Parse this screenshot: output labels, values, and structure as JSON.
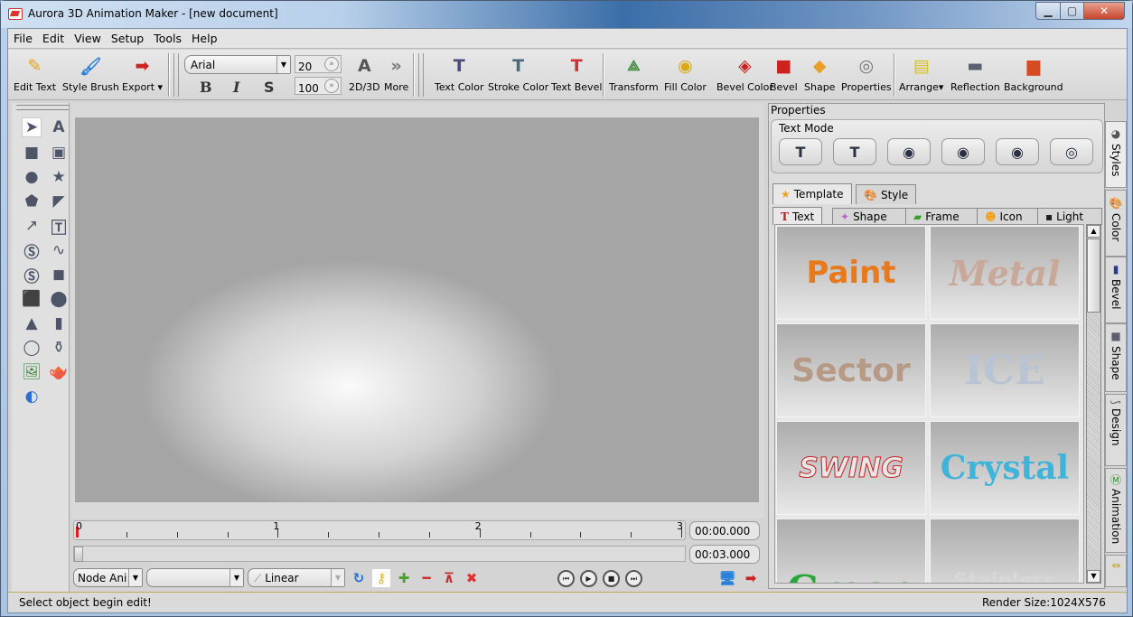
{
  "window": {
    "title": "Aurora 3D Animation Maker - [new document]"
  },
  "menu": [
    "File",
    "Edit",
    "View",
    "Setup",
    "Tools",
    "Help"
  ],
  "toolbar": {
    "edit_text": "Edit Text",
    "style_brush": "Style Brush",
    "export": "Export",
    "font": "Arial",
    "font_size": "20",
    "depth": "100",
    "bold": "B",
    "italic": "I",
    "strike": "S",
    "mode_2d3d": "2D/3D",
    "more": "More",
    "text_color": "Text Color",
    "stroke_color": "Stroke Color",
    "text_bevel": "Text Bevel",
    "transform": "Transform",
    "fill_color": "Fill Color",
    "bevel_color": "Bevel Color",
    "bevel": "Bevel",
    "shape": "Shape",
    "properties": "Properties",
    "arrange": "Arrange",
    "reflection": "Reflection",
    "background": "Background"
  },
  "timeline": {
    "labels": [
      "0",
      "1",
      "2",
      "3"
    ],
    "current_time": "00:00.000",
    "total_time": "00:03.000",
    "anim_type": "Node Ani",
    "anim_target": "",
    "interpolation": "Linear"
  },
  "status": {
    "message": "Select object begin edit!",
    "render_size": "Render Size:1024X576"
  },
  "properties": {
    "title": "Properties",
    "text_mode_label": "Text Mode",
    "tabs": [
      "Template",
      "Style"
    ],
    "subtabs": [
      "Text",
      "Shape",
      "Frame",
      "Icon",
      "Light"
    ],
    "templates": [
      {
        "label": "Paint",
        "color": "#e87a1e"
      },
      {
        "label": "Metal",
        "color": "#c8a898"
      },
      {
        "label": "Sector",
        "color": "#b79a86"
      },
      {
        "label": "ICE",
        "color": "#b8c4d4"
      },
      {
        "label": "SWING",
        "color": "#e8e8e8"
      },
      {
        "label": "Crystal",
        "color": "#3fb4d8"
      },
      {
        "label": "Green",
        "color": "#2aa63a"
      },
      {
        "label": "Stainless Steel",
        "color": "#d8d8d8"
      }
    ]
  },
  "side_tabs": [
    "Styles",
    "Color",
    "Bevel",
    "Shape",
    "Design",
    "Animation"
  ]
}
